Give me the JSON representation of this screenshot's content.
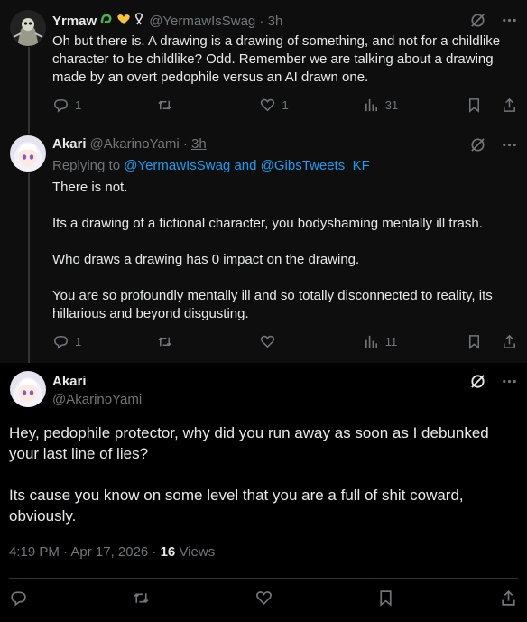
{
  "tweets": [
    {
      "name": "Yrmaw",
      "badges": [
        "snake-emoji-icon",
        "yellow-heart-icon",
        "ribbon-icon"
      ],
      "handle": "@YermawIsSwag",
      "time": "3h",
      "lines": [
        "Oh but there is. A drawing is a drawing of something, and not for a childlike character to be childlike? Odd. Remember we are talking about a drawing made by an overt pedophile versus an AI drawn one."
      ],
      "replies": "1",
      "retweets": "",
      "likes": "1",
      "views": "31"
    },
    {
      "name": "Akari",
      "handle": "@AkarinoYami",
      "time": "3h",
      "replying_prefix": "Replying to",
      "replying_to": "@YermawIsSwag and @GibsTweets_KF",
      "paragraphs": [
        "There is not.",
        "Its a drawing of a fictional character, you bodyshaming mentally ill trash.",
        "Who draws a drawing has 0 impact on the drawing.",
        "You are so profoundly mentally ill and so totally disconnected to reality, its hillarious and beyond disgusting."
      ],
      "replies": "1",
      "retweets": "",
      "likes": "",
      "views": "11"
    }
  ],
  "main": {
    "name": "Akari",
    "handle": "@AkarinoYami",
    "paragraphs": [
      "Hey, pedophile protector, why did you run away as soon as I debunked your last line of lies?",
      "Its cause you know on some level that you are a full of shit coward, obviously."
    ],
    "timestamp": "4:19 PM · Apr 17, 2026 · ",
    "views_count": "16",
    "views_label": "Views"
  },
  "colors": {
    "accent": "#1d9bf0",
    "muted": "#71767b",
    "text": "#e7e9ea",
    "bg": "#000000"
  }
}
